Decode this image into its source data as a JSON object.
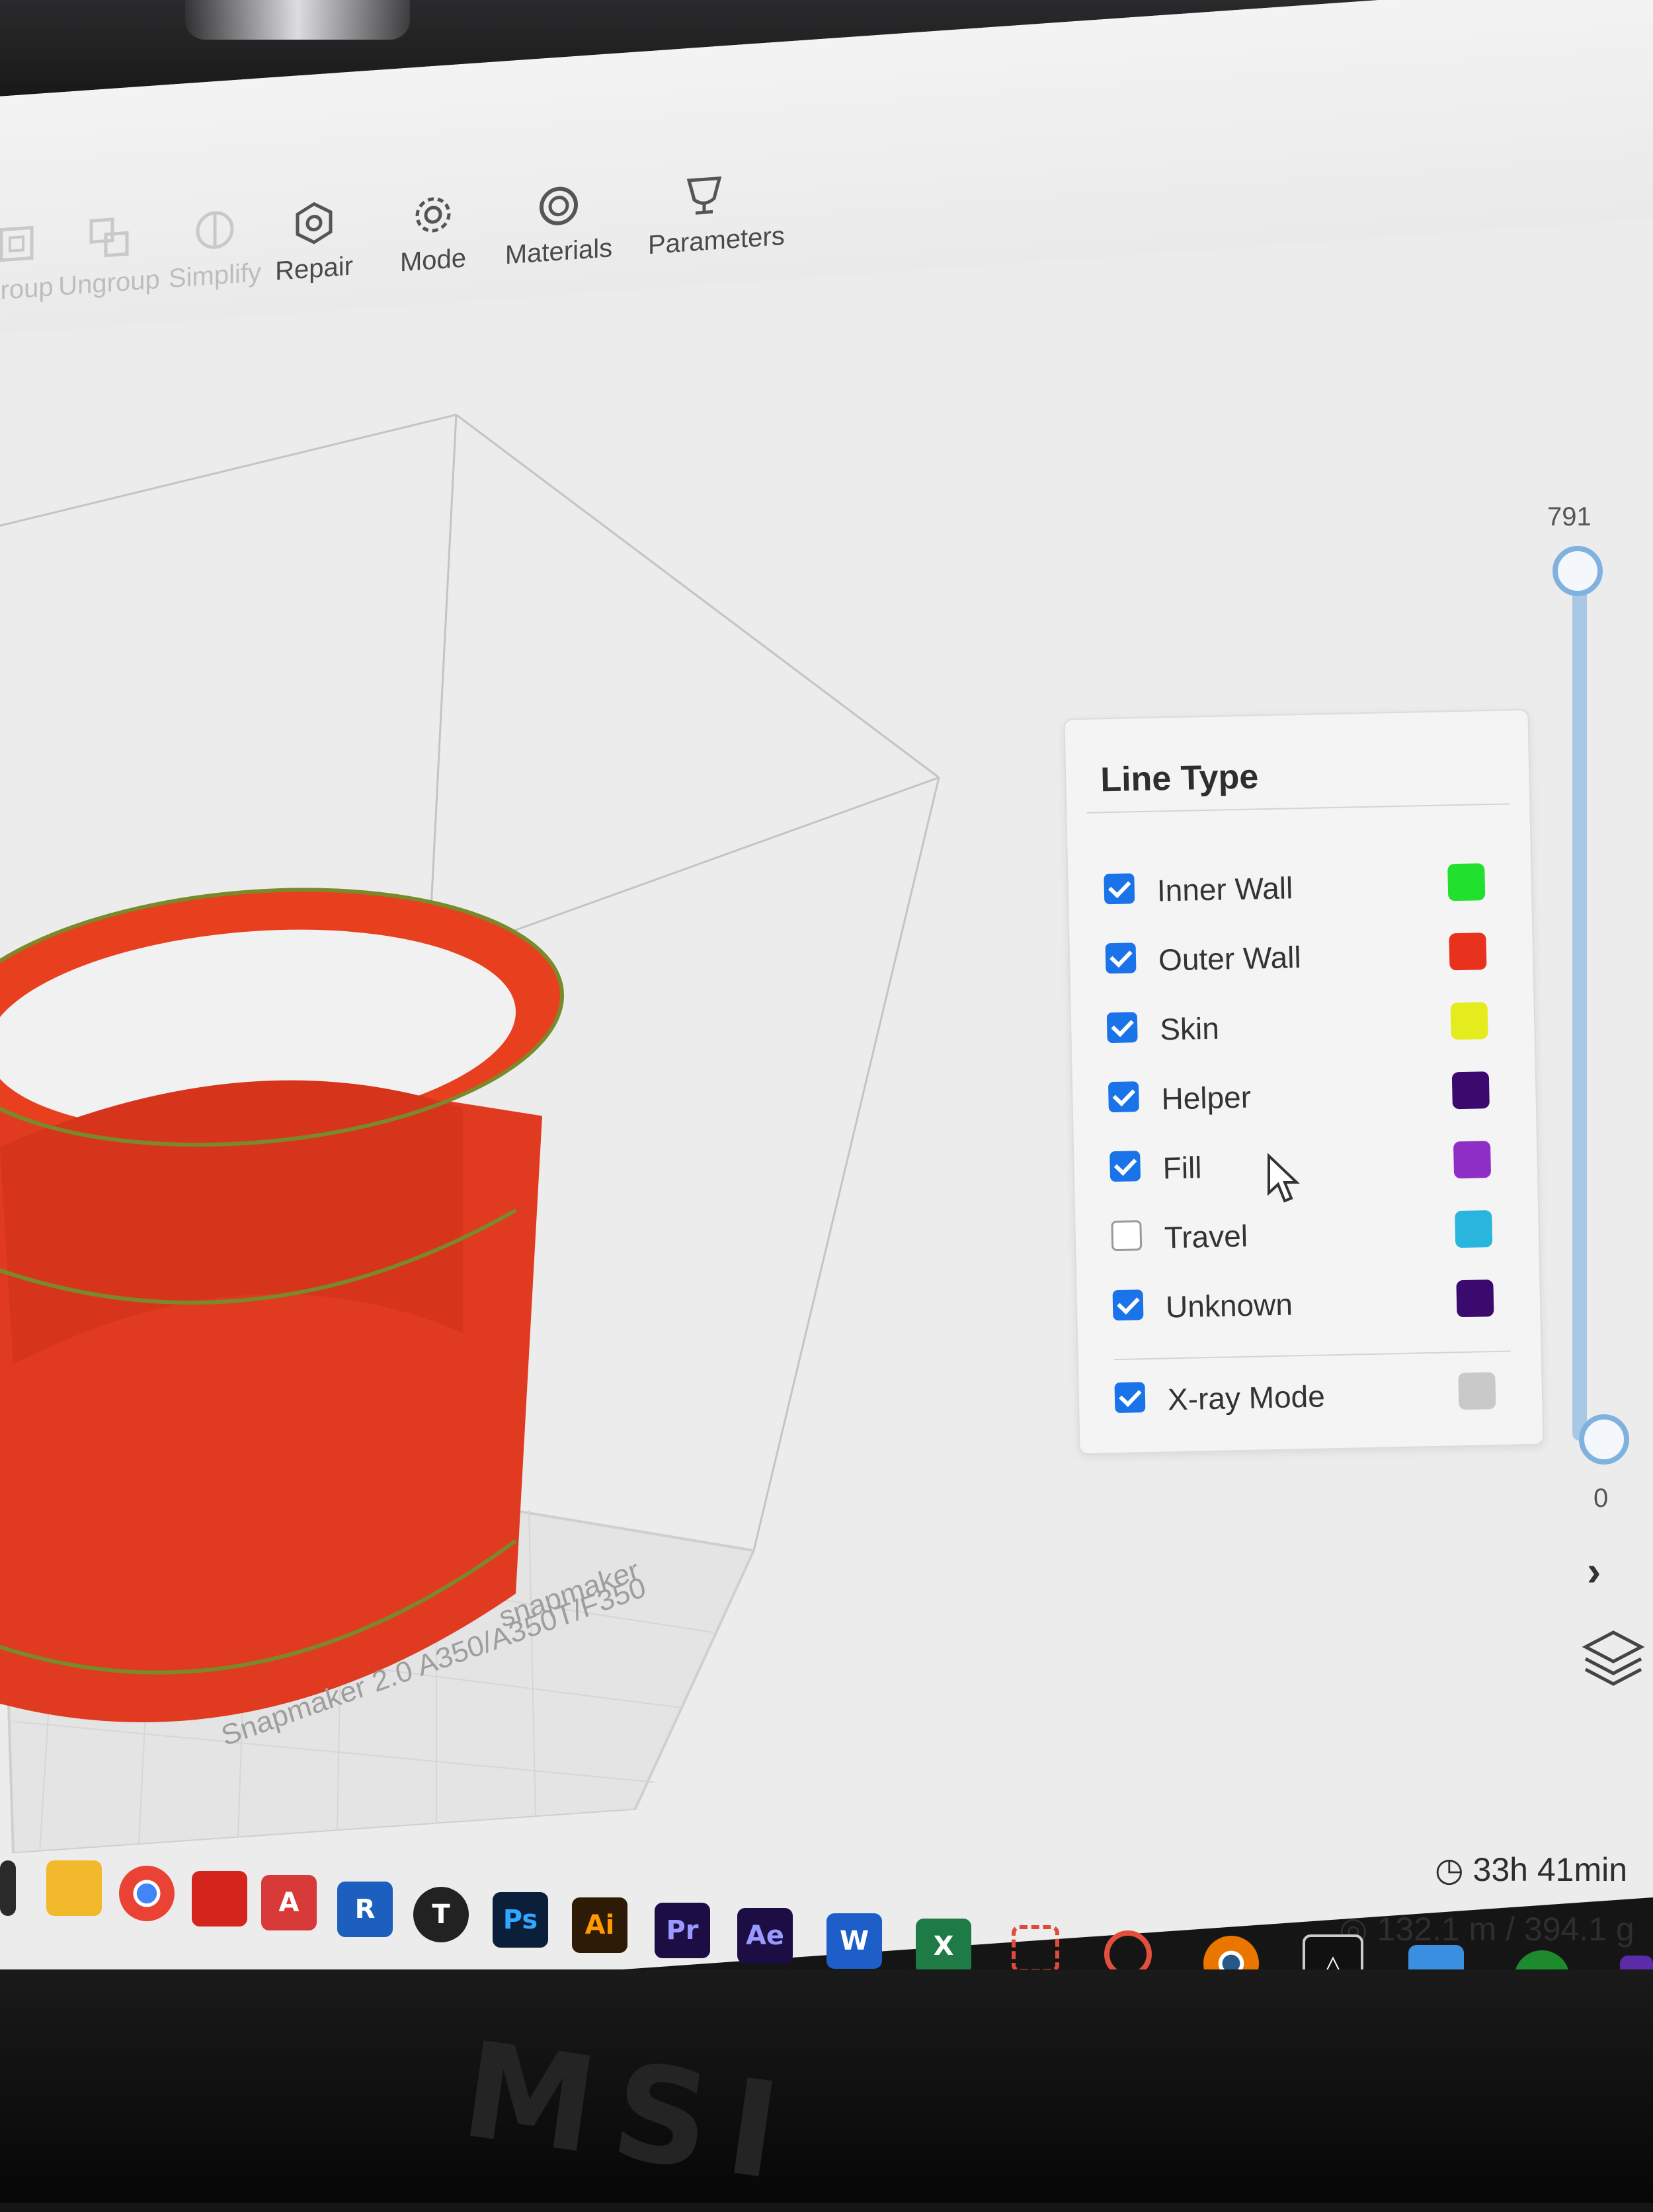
{
  "toolbar": {
    "items": [
      {
        "label": "Group",
        "icon": "group-icon",
        "enabled": false
      },
      {
        "label": "Ungroup",
        "icon": "ungroup-icon",
        "enabled": false
      },
      {
        "label": "Simplify",
        "icon": "simplify-icon",
        "enabled": false
      },
      {
        "label": "Repair",
        "icon": "repair-icon",
        "enabled": true
      },
      {
        "label": "Mode",
        "icon": "gear-icon",
        "enabled": true
      },
      {
        "label": "Materials",
        "icon": "spool-icon",
        "enabled": true
      },
      {
        "label": "Parameters",
        "icon": "parameters-icon",
        "enabled": true
      }
    ]
  },
  "viewport": {
    "build_plate_brand": "snapmaker",
    "build_plate_model": "Snapmaker 2.0 A350/A350T/F350"
  },
  "layer_slider": {
    "max": "791",
    "min": "0"
  },
  "line_type_panel": {
    "title": "Line Type",
    "items": [
      {
        "name": "Inner Wall",
        "checked": true,
        "color": "#22e02e"
      },
      {
        "name": "Outer Wall",
        "checked": true,
        "color": "#e8321e"
      },
      {
        "name": "Skin",
        "checked": true,
        "color": "#e4ec1e"
      },
      {
        "name": "Helper",
        "checked": true,
        "color": "#3b0a6e"
      },
      {
        "name": "Fill",
        "checked": true,
        "color": "#8e2ec6"
      },
      {
        "name": "Travel",
        "checked": false,
        "color": "#2ab6dc"
      },
      {
        "name": "Unknown",
        "checked": true,
        "color": "#3b0a6e"
      }
    ],
    "xray": {
      "name": "X-ray Mode",
      "checked": true,
      "color": "#c9c9c9"
    }
  },
  "stats": {
    "print_time": "33h 41min",
    "material_usage": "132.1 m / 394.1 g"
  },
  "taskbar": {
    "apps": [
      {
        "name": "file-explorer",
        "label": "",
        "color": "#f2b92c"
      },
      {
        "name": "chrome",
        "label": "",
        "color": "#ea4335"
      },
      {
        "name": "acrobat",
        "label": "",
        "color": "#d4251c"
      },
      {
        "name": "autocad",
        "label": "A",
        "color": "#d83a3a"
      },
      {
        "name": "revit",
        "label": "R",
        "color": "#1d5fbf"
      },
      {
        "name": "app-t",
        "label": "T",
        "color": "#222222"
      },
      {
        "name": "photoshop",
        "label": "Ps",
        "color": "#0b1e3a"
      },
      {
        "name": "illustrator",
        "label": "Ai",
        "color": "#2e1b06"
      },
      {
        "name": "premiere",
        "label": "Pr",
        "color": "#1c0e44"
      },
      {
        "name": "after-effects",
        "label": "Ae",
        "color": "#1c0e44"
      },
      {
        "name": "word",
        "label": "W",
        "color": "#1d5ec8"
      },
      {
        "name": "excel",
        "label": "X",
        "color": "#1e7b45"
      },
      {
        "name": "snipping-tool",
        "label": "",
        "color": "#e04a3a"
      },
      {
        "name": "app-swirl",
        "label": "",
        "color": "#e0503c"
      },
      {
        "name": "blender",
        "label": "",
        "color": "#ea7600"
      },
      {
        "name": "snapmaker-luban",
        "label": "",
        "color": "#111111"
      },
      {
        "name": "3d-builder",
        "label": "",
        "color": "#3a8fe0"
      },
      {
        "name": "xbox",
        "label": "",
        "color": "#1e8a2e"
      },
      {
        "name": "app-purple",
        "label": "",
        "color": "#5b2ba8"
      }
    ]
  }
}
